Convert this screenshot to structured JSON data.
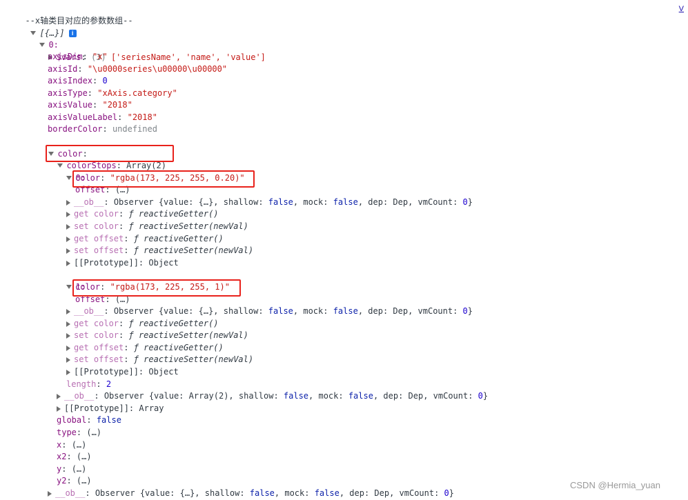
{
  "header": {
    "label": "--x轴类目对应的参数数组--",
    "source_link": "V"
  },
  "root": {
    "text": "[{…}]",
    "info_icon": "i"
  },
  "item0": {
    "index": "0:"
  },
  "vars": {
    "key": "$vars",
    "sep": ": ",
    "count": "(3) ",
    "value": "['seriesName', 'name', 'value']"
  },
  "axisDim": {
    "key": "axisDim",
    "sep": ": ",
    "value": "\"x\""
  },
  "axisId": {
    "key": "axisId",
    "sep": ": ",
    "value": "\"\\u0000series\\u00000\\u00000\""
  },
  "axisIndex": {
    "key": "axisIndex",
    "sep": ": ",
    "value": "0"
  },
  "axisType": {
    "key": "axisType",
    "sep": ": ",
    "value": "\"xAxis.category\""
  },
  "axisValue": {
    "key": "axisValue",
    "sep": ": ",
    "value": "\"2018\""
  },
  "axisValueLabel": {
    "key": "axisValueLabel",
    "sep": ": ",
    "value": "\"2018\""
  },
  "borderColor": {
    "key": "borderColor",
    "sep": ": ",
    "value": "undefined"
  },
  "color": {
    "key": "color",
    "sep": ":"
  },
  "colorStops": {
    "key": "colorStops",
    "sep": ": ",
    "value": "Array(2)"
  },
  "stop0": {
    "index": "0:",
    "color": {
      "key": "color",
      "sep": ": ",
      "value": "\"rgba(173, 225, 255, 0.20)\""
    },
    "offset": {
      "key": "offset",
      "sep": ": ",
      "value": "(…)"
    },
    "ob": {
      "key": "__ob__",
      "sep": ": ",
      "value_pre": "Observer {value: {…}, shallow: ",
      "shallow": "false",
      "mid1": ", mock: ",
      "mock": "false",
      "mid2": ", dep: Dep, vmCount: ",
      "vmCount": "0",
      "end": "}"
    },
    "getColor": {
      "key": "get color",
      "sep": ": ",
      "f": "ƒ ",
      "value": "reactiveGetter()"
    },
    "setColor": {
      "key": "set color",
      "sep": ": ",
      "f": "ƒ ",
      "value": "reactiveSetter(newVal)"
    },
    "getOffset": {
      "key": "get offset",
      "sep": ": ",
      "f": "ƒ ",
      "value": "reactiveGetter()"
    },
    "setOffset": {
      "key": "set offset",
      "sep": ": ",
      "f": "ƒ ",
      "value": "reactiveSetter(newVal)"
    },
    "proto": {
      "key": "[[Prototype]]",
      "sep": ": ",
      "value": "Object"
    }
  },
  "stop1": {
    "index": "1:",
    "color": {
      "key": "color",
      "sep": ": ",
      "value": "\"rgba(173, 225, 255, 1)\""
    },
    "offset": {
      "key": "offset",
      "sep": ": ",
      "value": "(…)"
    },
    "ob": {
      "key": "__ob__",
      "sep": ": ",
      "value_pre": "Observer {value: {…}, shallow: ",
      "shallow": "false",
      "mid1": ", mock: ",
      "mock": "false",
      "mid2": ", dep: Dep, vmCount: ",
      "vmCount": "0",
      "end": "}"
    },
    "getColor": {
      "key": "get color",
      "sep": ": ",
      "f": "ƒ ",
      "value": "reactiveGetter()"
    },
    "setColor": {
      "key": "set color",
      "sep": ": ",
      "f": "ƒ ",
      "value": "reactiveSetter(newVal)"
    },
    "getOffset": {
      "key": "get offset",
      "sep": ": ",
      "f": "ƒ ",
      "value": "reactiveGetter()"
    },
    "setOffset": {
      "key": "set offset",
      "sep": ": ",
      "f": "ƒ ",
      "value": "reactiveSetter(newVal)"
    },
    "proto": {
      "key": "[[Prototype]]",
      "sep": ": ",
      "value": "Object"
    }
  },
  "length": {
    "key": "length",
    "sep": ": ",
    "value": "2"
  },
  "arrOb": {
    "key": "__ob__",
    "sep": ": ",
    "value_pre": "Observer {value: Array(2), shallow: ",
    "shallow": "false",
    "mid1": ", mock: ",
    "mock": "false",
    "mid2": ", dep: Dep, vmCount: ",
    "vmCount": "0",
    "end": "}"
  },
  "arrProto": {
    "key": "[[Prototype]]",
    "sep": ": ",
    "value": "Array"
  },
  "global": {
    "key": "global",
    "sep": ": ",
    "value": "false"
  },
  "type": {
    "key": "type",
    "sep": ": ",
    "value": "(…)"
  },
  "x": {
    "key": "x",
    "sep": ": ",
    "value": "(…)"
  },
  "x2": {
    "key": "x2",
    "sep": ": ",
    "value": "(…)"
  },
  "y": {
    "key": "y",
    "sep": ": ",
    "value": "(…)"
  },
  "y2": {
    "key": "y2",
    "sep": ": ",
    "value": "(…)"
  },
  "colorOb": {
    "key": "__ob__",
    "sep": ": ",
    "value_pre": "Observer {value: {…}, shallow: ",
    "shallow": "false",
    "mid1": ", mock: ",
    "mock": "false",
    "mid2": ", dep: Dep, vmCount: ",
    "vmCount": "0",
    "end": "}"
  },
  "watermark": "CSDN @Hermia_yuan",
  "colors": {
    "highlight_box": "#e8211b",
    "key": "#881280",
    "string": "#c41a16",
    "number": "#1c00cf",
    "keyword": "#0d22aa"
  }
}
